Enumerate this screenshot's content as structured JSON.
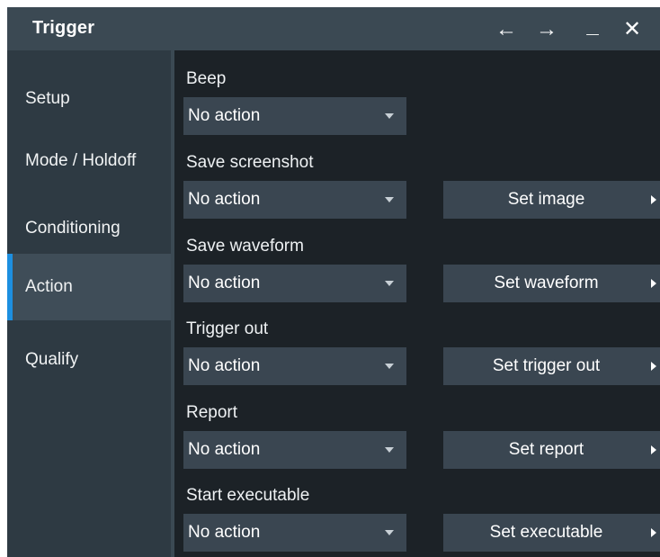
{
  "window": {
    "title": "Trigger",
    "controls": {
      "back": "←",
      "forward": "→",
      "minimize": "_",
      "close": "✕"
    }
  },
  "sidebar": {
    "items": [
      {
        "label": "Setup",
        "active": false
      },
      {
        "label": "Mode / Holdoff",
        "active": false
      },
      {
        "label": "Conditioning",
        "active": false
      },
      {
        "label": "Action",
        "active": true
      },
      {
        "label": "Qualify",
        "active": false
      }
    ]
  },
  "actions": {
    "beep": {
      "label": "Beep",
      "value": "No action"
    },
    "screenshot": {
      "label": "Save screenshot",
      "value": "No action",
      "button": "Set image"
    },
    "waveform": {
      "label": "Save waveform",
      "value": "No action",
      "button": "Set waveform"
    },
    "trigger_out": {
      "label": "Trigger out",
      "value": "No action",
      "button": "Set trigger out"
    },
    "report": {
      "label": "Report",
      "value": "No action",
      "button": "Set report"
    },
    "executable": {
      "label": "Start executable",
      "value": "No action",
      "button": "Set executable"
    }
  },
  "colors": {
    "background": "#1c2227",
    "titlebar": "#3b4953",
    "sidebar": "#2e3a43",
    "active_item": "#3f4d58",
    "accent": "#1d8fe0",
    "control": "#3a4651"
  }
}
